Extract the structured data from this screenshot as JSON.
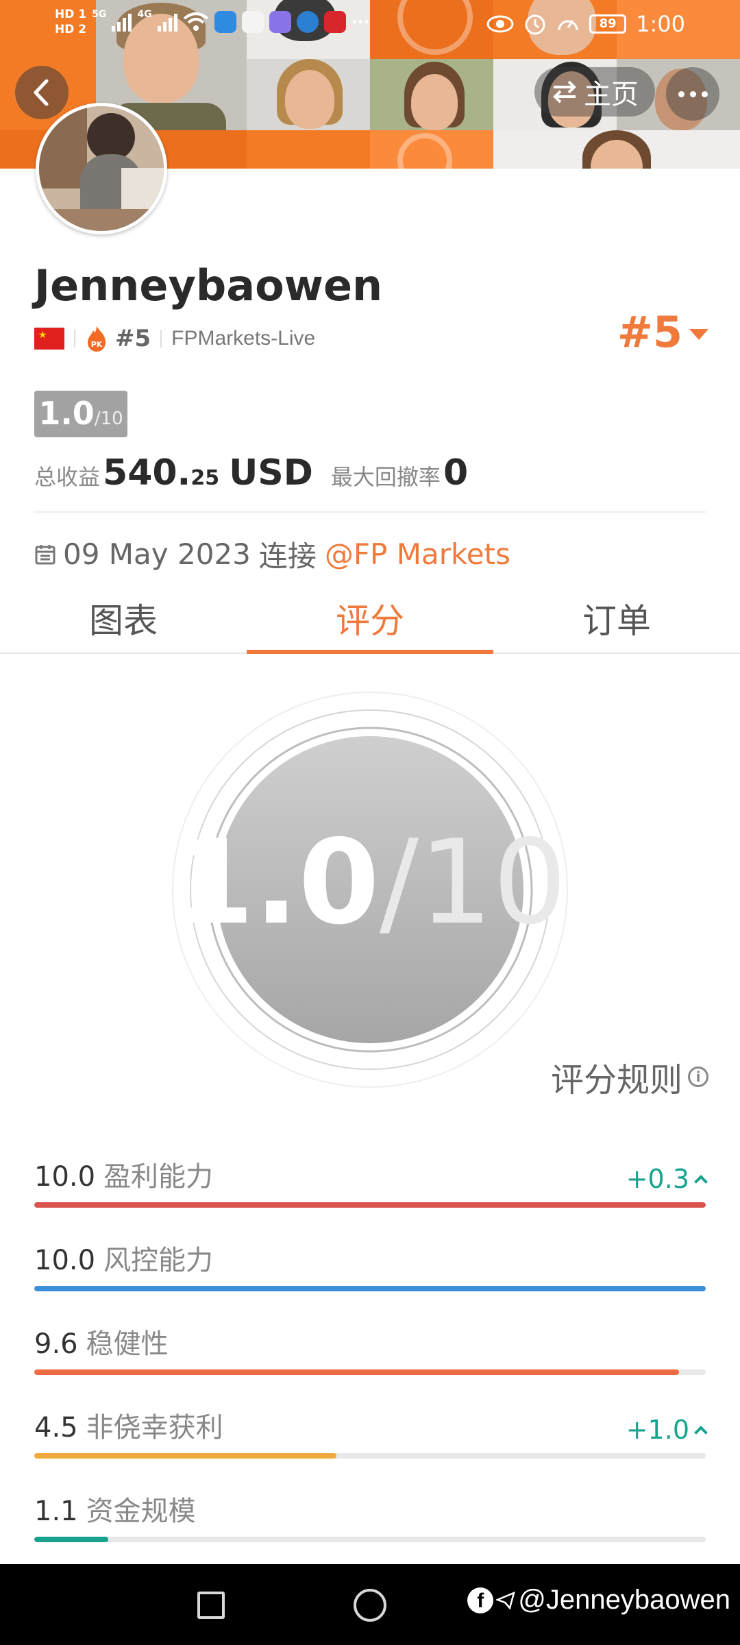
{
  "status_bar": {
    "hd1": "HD 1",
    "hd2": "HD 2",
    "net1": "5G",
    "net2": "4G",
    "battery": "89",
    "time": "1:00"
  },
  "header": {
    "home_label": "主页"
  },
  "profile": {
    "username": "Jenneybaowen",
    "rank": "#5",
    "broker": "FPMarkets-Live",
    "rank_big": "#5",
    "score_value": "1.0",
    "score_denominator": "/10",
    "total_earnings_label": "总收益",
    "total_earnings_int": "540.",
    "total_earnings_dec": "25",
    "currency": "USD",
    "max_drawdown_label": "最大回撤率",
    "max_drawdown_value": "0",
    "connected_date": "09 May 2023",
    "connected_label": "连接",
    "connected_broker": "@FP Markets"
  },
  "tabs": [
    {
      "label": "图表",
      "active": false
    },
    {
      "label": "评分",
      "active": true
    },
    {
      "label": "订单",
      "active": false
    }
  ],
  "gauge": {
    "score": "1.0",
    "total": "/10"
  },
  "rules_label": "评分规则",
  "metrics": [
    {
      "value": "10.0",
      "label": "盈利能力",
      "change": "+0.3",
      "fraction": 1.0,
      "color": "#d9534f"
    },
    {
      "value": "10.0",
      "label": "风控能力",
      "change": "",
      "fraction": 1.0,
      "color": "#3b8ed8"
    },
    {
      "value": "9.6",
      "label": "稳健性",
      "change": "",
      "fraction": 0.96,
      "color": "#ec6b42"
    },
    {
      "value": "4.5",
      "label": "非侥幸获利",
      "change": "+1.0",
      "fraction": 0.45,
      "color": "#f0a93c"
    },
    {
      "value": "1.1",
      "label": "资金规模",
      "change": "",
      "fraction": 0.11,
      "color": "#17a38e"
    }
  ],
  "watermark": "@Jenneybaowen",
  "colors": {
    "accent": "#f07a3c",
    "positive": "#17a38e",
    "badge": "#a3a3a3"
  }
}
